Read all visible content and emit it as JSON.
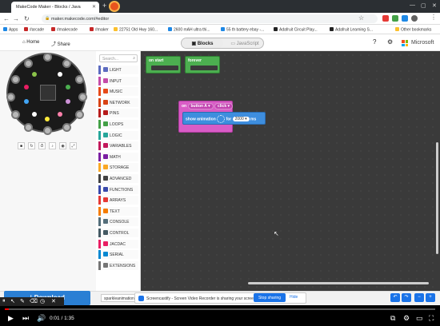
{
  "browser": {
    "tab_title": "MakeCode Maker - Blocks / Java",
    "url": "maker.makecode.com/#editor",
    "bookmarks": [
      "Apps",
      "#arcade",
      "#makecode",
      "#maker",
      "22751 Old Hwy 160...",
      "2600 mAH ultra thi...",
      "55 th battery ebay -...",
      "Adafruit Circuit Play...",
      "Adafruit Learning S...",
      "Other bookmarks"
    ]
  },
  "header": {
    "home_label": "Home",
    "share_label": "Share",
    "blocks_label": "Blocks",
    "javascript_label": "JavaScript",
    "brand_label": "Microsoft"
  },
  "toolbox": {
    "search_placeholder": "Search...",
    "categories": [
      {
        "label": "LIGHT",
        "color": "#5c6bc0"
      },
      {
        "label": "INPUT",
        "color": "#c44ca8"
      },
      {
        "label": "MUSIC",
        "color": "#e64a19"
      },
      {
        "label": "NETWORK",
        "color": "#d84315"
      },
      {
        "label": "PINS",
        "color": "#b71c1c"
      },
      {
        "label": "LOOPS",
        "color": "#43a047"
      },
      {
        "label": "LOGIC",
        "color": "#26a69a"
      },
      {
        "label": "VARIABLES",
        "color": "#c2185b"
      },
      {
        "label": "MATH",
        "color": "#7b1fa2"
      },
      {
        "label": "STORAGE",
        "color": "#f9a825"
      },
      {
        "label": "ADVANCED",
        "color": "#424242"
      },
      {
        "label": "FUNCTIONS",
        "color": "#3949ab"
      },
      {
        "label": "ARRAYS",
        "color": "#e53935"
      },
      {
        "label": "TEXT",
        "color": "#f57c00"
      },
      {
        "label": "CONSOLE",
        "color": "#546e7a"
      },
      {
        "label": "CONTROL",
        "color": "#455a64"
      },
      {
        "label": "JACDAC",
        "color": "#e91e63"
      },
      {
        "label": "SERIAL",
        "color": "#0288d1"
      },
      {
        "label": "EXTENSIONS",
        "color": "#757575"
      }
    ]
  },
  "workspace": {
    "on_start_label": "on start",
    "forever_label": "forever",
    "event_block_label": "on",
    "event_button": "button A",
    "event_action": "click",
    "show_animation_label": "show animation",
    "for_label": "for",
    "duration_value": "2000",
    "unit_label": "ms"
  },
  "bottom": {
    "download_label": "Download",
    "project_name": "sparkleanimation1",
    "notification_text": "Screencastify - Screen Video Recorder is sharing your screen.",
    "stop_sharing_label": "Stop sharing",
    "hide_label": "Hide"
  },
  "video": {
    "current_time": "0:01",
    "duration": "1:35",
    "time_display": "0:01 / 1:35",
    "progress": 0.01
  },
  "colors": {
    "accent": "#2a7fd4",
    "loop_green": "#4caf50",
    "input_pink": "#d95cc6",
    "progress_red": "#ff0000"
  }
}
